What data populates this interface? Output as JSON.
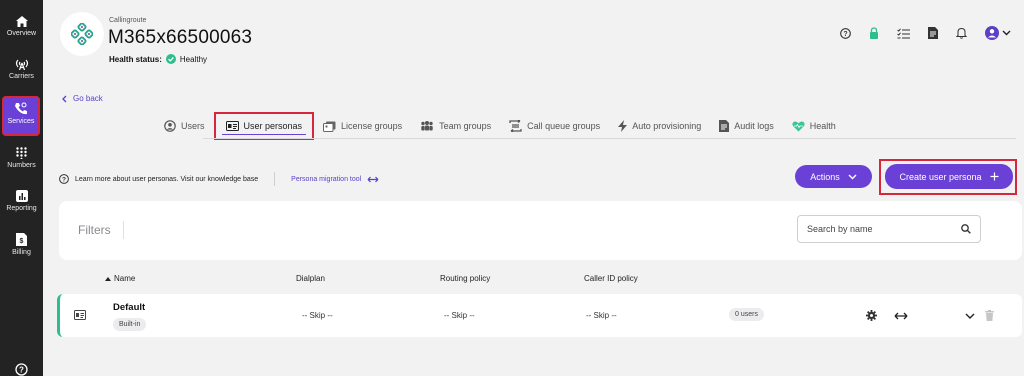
{
  "nav": {
    "items": [
      {
        "label": "Overview",
        "icon": "home-icon"
      },
      {
        "label": "Carriers",
        "icon": "antenna-icon"
      },
      {
        "label": "Services",
        "icon": "phone-settings-icon",
        "active": true
      },
      {
        "label": "Numbers",
        "icon": "dialpad-icon"
      },
      {
        "label": "Reporting",
        "icon": "bar-chart-icon"
      },
      {
        "label": "Billing",
        "icon": "invoice-icon"
      }
    ]
  },
  "header": {
    "subtitle": "Callingroute",
    "title": "M365x66500063",
    "health_label": "Health status:",
    "health_value": "Healthy"
  },
  "go_back": "Go back",
  "tabs": [
    {
      "label": "Users",
      "icon": "users-icon"
    },
    {
      "label": "User personas",
      "icon": "id-card-icon",
      "active": true
    },
    {
      "label": "License groups",
      "icon": "license-icon"
    },
    {
      "label": "Team groups",
      "icon": "team-icon"
    },
    {
      "label": "Call queue groups",
      "icon": "queue-icon"
    },
    {
      "label": "Auto provisioning",
      "icon": "lightning-icon"
    },
    {
      "label": "Audit logs",
      "icon": "document-icon"
    },
    {
      "label": "Health",
      "icon": "heart-icon"
    }
  ],
  "info": {
    "text": "Learn more about user personas. Visit our knowledge base",
    "migration_link": "Persona migration tool"
  },
  "actions_label": "Actions",
  "create_label": "Create user persona",
  "filters": {
    "title": "Filters",
    "search_placeholder": "Search by name"
  },
  "table": {
    "columns": [
      "Name",
      "Dialplan",
      "Routing policy",
      "Caller ID policy"
    ],
    "rows": [
      {
        "name": "Default",
        "tag": "Built-in",
        "dialplan": "-- Skip --",
        "routing_policy": "-- Skip --",
        "caller_id_policy": "-- Skip --",
        "users": "0 users"
      }
    ]
  },
  "colors": {
    "nav_bg": "#232323",
    "accent": "#6a40d6",
    "highlight": "#d7273c",
    "healthy": "#2dbf8b"
  }
}
